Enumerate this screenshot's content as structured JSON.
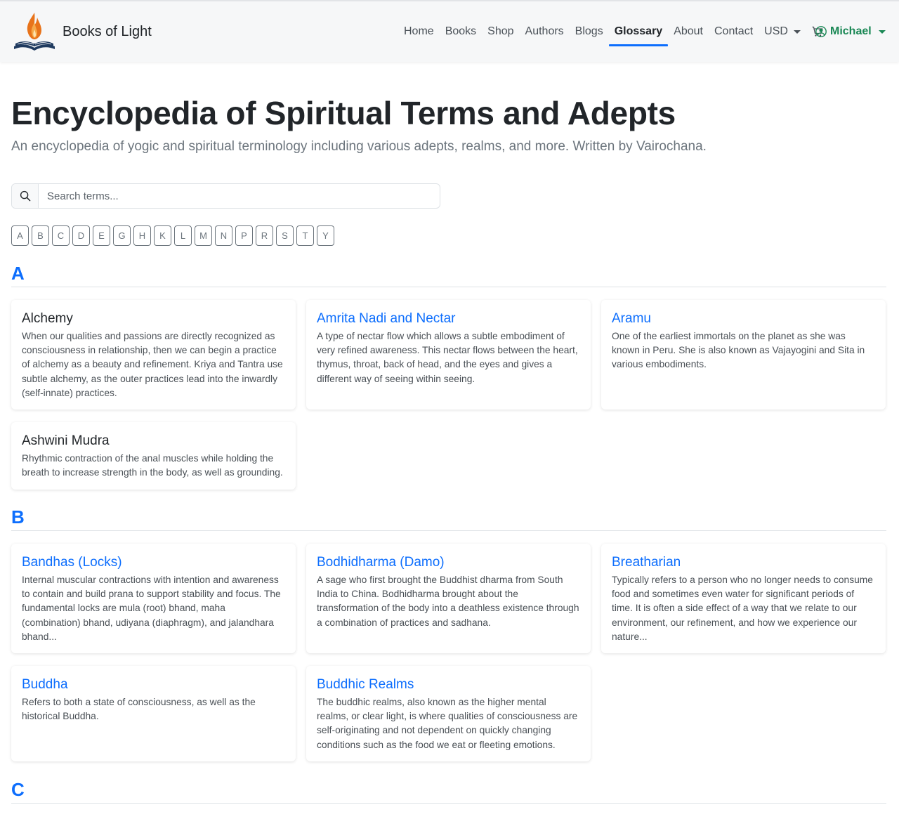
{
  "site": {
    "name": "Books of Light",
    "logo_icon": "book-flame-logo-icon",
    "colors": {
      "accent": "#0d6efd",
      "user": "#198754",
      "flame": "#e8731a",
      "book": "#1f3a5f"
    }
  },
  "nav": {
    "items": [
      {
        "label": "Home"
      },
      {
        "label": "Books"
      },
      {
        "label": "Shop"
      },
      {
        "label": "Authors"
      },
      {
        "label": "Blogs"
      },
      {
        "label": "Glossary",
        "active": true
      },
      {
        "label": "About"
      },
      {
        "label": "Contact"
      }
    ],
    "currency": "USD",
    "cart_icon": "cart-icon",
    "user_name": "Michael",
    "user_icon": "user-circle-icon"
  },
  "header": {
    "title": "Encyclopedia of Spiritual Terms and Adepts",
    "subtitle": "An encyclopedia of yogic and spiritual terminology including various adepts, realms, and more. Written by Vairochana."
  },
  "search": {
    "placeholder": "Search terms...",
    "value": "",
    "icon": "search-icon"
  },
  "letters": [
    "A",
    "B",
    "C",
    "D",
    "E",
    "G",
    "H",
    "K",
    "L",
    "M",
    "N",
    "P",
    "R",
    "S",
    "T",
    "Y"
  ],
  "sections": [
    {
      "letter": "A",
      "entries": [
        {
          "title": "Alchemy",
          "linked": false,
          "text": "When our qualities and passions are directly recognized as consciousness in relationship, then we can begin a practice of alchemy as a beauty and refinement. Kriya and Tantra use subtle alchemy, as the outer practices lead into the inwardly (self-innate) practices."
        },
        {
          "title": "Amrita Nadi and Nectar",
          "linked": true,
          "text": "A type of nectar flow which allows a subtle embodiment of very refined awareness. This nectar flows between the heart, thymus, throat, back of head, and the eyes and gives a different way of seeing within seeing."
        },
        {
          "title": "Aramu",
          "linked": true,
          "text": "One of the earliest immortals on the planet as she was known in Peru. She is also known as Vajayogini and Sita in various embodiments."
        },
        {
          "title": "Ashwini Mudra",
          "linked": false,
          "text": "Rhythmic contraction of the anal muscles while holding the breath to increase strength in the body, as well as grounding."
        }
      ]
    },
    {
      "letter": "B",
      "entries": [
        {
          "title": "Bandhas (Locks)",
          "linked": true,
          "text": "Internal muscular contractions with intention and awareness to contain and build prana to support stability and focus. The fundamental locks are mula (root) bhand, maha (combination) bhand, udiyana (diaphragm), and jalandhara bhand..."
        },
        {
          "title": "Bodhidharma (Damo)",
          "linked": true,
          "text": "A sage who first brought the Buddhist dharma from South India to China. Bodhidharma brought about the transformation of the body into a deathless existence through a combination of practices and sadhana."
        },
        {
          "title": "Breatharian",
          "linked": true,
          "text": "Typically refers to a person who no longer needs to consume food and sometimes even water for significant periods of time. It is often a side effect of a way that we relate to our environment, our refinement, and how we experience our nature..."
        },
        {
          "title": "Buddha",
          "linked": true,
          "text": "Refers to both a state of consciousness, as well as the historical Buddha."
        },
        {
          "title": "Buddhic Realms",
          "linked": true,
          "text": "The buddhic realms, also known as the higher mental realms, or clear light, is where qualities of consciousness are self-originating and not dependent on quickly changing conditions such as the food we eat or fleeting emotions."
        }
      ]
    },
    {
      "letter": "C",
      "entries": []
    }
  ]
}
